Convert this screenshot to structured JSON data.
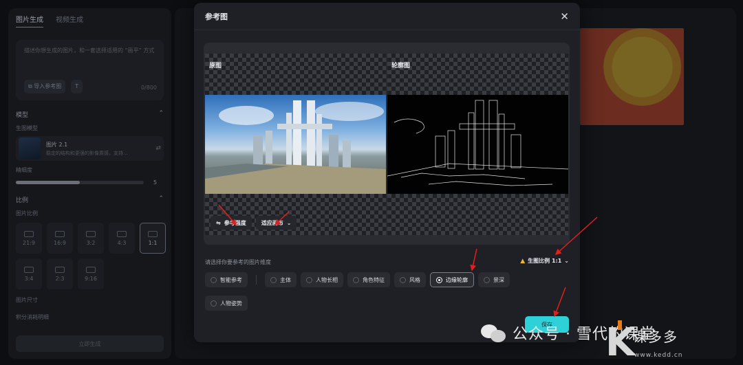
{
  "left": {
    "tabs": [
      "图片生成",
      "视频生成"
    ],
    "prompt_placeholder": "描述你想生成的图片，和一套选择适用的 “画平” 方式",
    "import_ref": "导入参考图",
    "char_count": "0/800",
    "model_section": "模型",
    "gen_model_label": "生图模型",
    "model_name": "图片 2.1",
    "model_desc": "稳定的结构和更强的影像质感，支持...",
    "precision_label": "精细度",
    "precision_value": "5",
    "precision_fraction": 0.5,
    "ratio_section": "比例",
    "ratio_label": "图片比例",
    "ratios": [
      "21:9",
      "16:9",
      "3:2",
      "4:3",
      "1:1",
      "3:4",
      "2:3",
      "9:16"
    ],
    "selected_ratio": "1:1",
    "size_label": "图片尺寸",
    "credits_label": "积分消耗明细",
    "generate": "立即生成"
  },
  "modal": {
    "title": "参考图",
    "close": "✕",
    "original_label": "原图",
    "contour_label": "轮廓图",
    "strength_btn": "参考强度",
    "fit_btn": "适应画布",
    "hint": "请选择你要参考的图片维度",
    "ratio_btn": "生图比例 1:1",
    "dimensions": [
      "智能参考",
      "主体",
      "人物长相",
      "角色特征",
      "风格",
      "边缘轮廓",
      "景深",
      "人物姿势"
    ],
    "selected_dimension": "边缘轮廓",
    "save": "保存"
  },
  "watermark": {
    "wechat": "公众号 · 雪代的课堂",
    "brand": "课多多",
    "url": "www.kedd.cn"
  },
  "colors": {
    "accent": "#2fd1d9",
    "warning": "#f2b633",
    "annotation": "#e0201c"
  }
}
